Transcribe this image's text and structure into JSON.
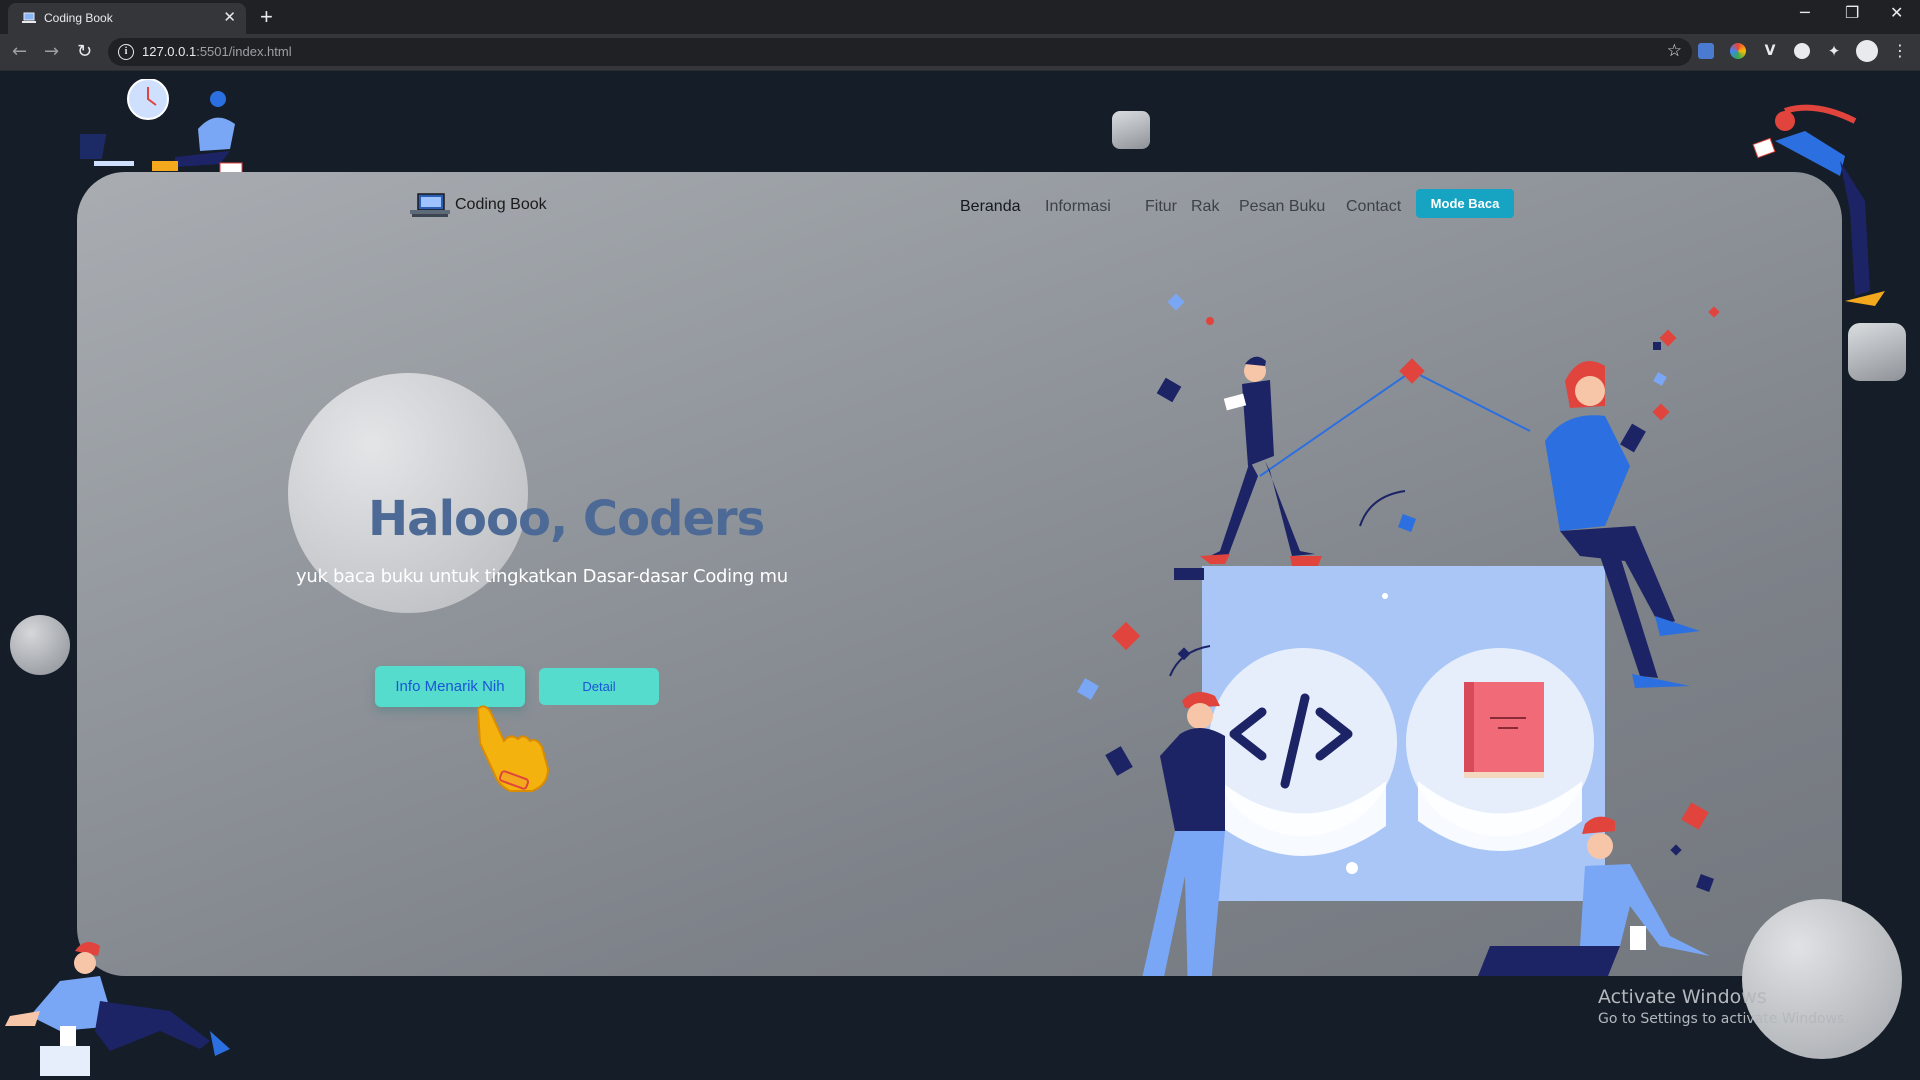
{
  "browser": {
    "tab_title": "Coding Book",
    "tab_close": "✕",
    "new_tab": "+",
    "url_host": "127.0.0.1",
    "url_rest": ":5501/index.html",
    "window_minimize": "─",
    "window_restore": "❐",
    "window_close": "✕"
  },
  "site": {
    "logo_text": "Coding Book",
    "nav": [
      "Beranda",
      "Informasi",
      "Fitur",
      "Rak",
      "Pesan Buku",
      "Contact"
    ],
    "mode_button": "Mode Baca"
  },
  "hero": {
    "title": "Halooo, Coders",
    "subtitle": "yuk baca buku untuk tingkatkan Dasar-dasar Coding mu",
    "button_info": "Info Menarik Nih",
    "button_detail": "Detail"
  },
  "windows_watermark": {
    "line1": "Activate Windows",
    "line2": "Go to Settings to activate Windows."
  },
  "colors": {
    "page_bg": "#151d28",
    "accent_teal": "#55dccc",
    "accent_blue": "#1a55d6",
    "title_blue": "#4c6a95",
    "mode_btn": "#17a4c2"
  },
  "icons": [
    "back-icon",
    "forward-icon",
    "reload-icon",
    "info-icon",
    "star-icon",
    "extensions-icon",
    "menu-icon",
    "pointer-hand-icon",
    "code-icon",
    "book-icon"
  ]
}
